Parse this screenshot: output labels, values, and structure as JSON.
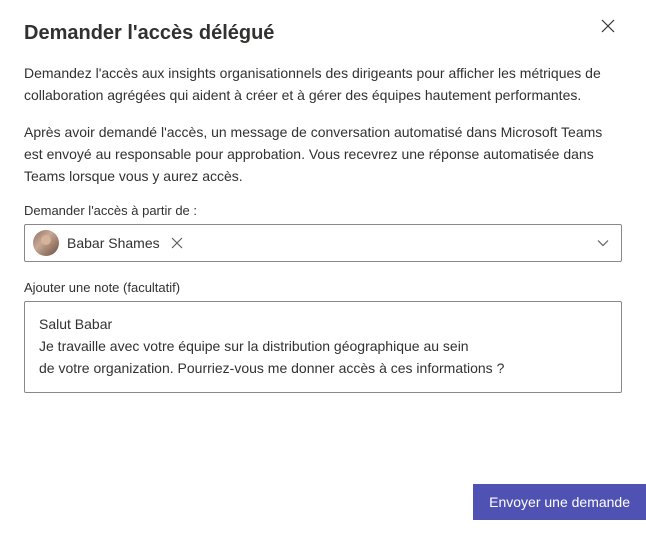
{
  "dialog": {
    "title": "Demander l'accès délégué",
    "description1": "Demandez l'accès aux insights organisationnels des dirigeants pour afficher les métriques de collaboration agrégées qui aident à créer et à gérer des équipes hautement performantes.",
    "description2": "Après avoir demandé l'accès, un message de conversation automatisé dans Microsoft Teams est envoyé au responsable pour approbation. Vous recevrez une réponse automatisée dans Teams lorsque vous y aurez accès.",
    "requestFromLabel": "Demander l'accès à partir de :",
    "person": {
      "name": "Babar Shames"
    },
    "noteLabel": "Ajouter une note (facultatif)",
    "noteLine1": "Salut Babar",
    "noteLine2": "Je travaille avec votre équipe sur la distribution géographique au sein",
    "noteLine3": "de votre organization. Pourriez-vous me donner accès à ces informations ?",
    "submitLabel": "Envoyer une demande"
  }
}
